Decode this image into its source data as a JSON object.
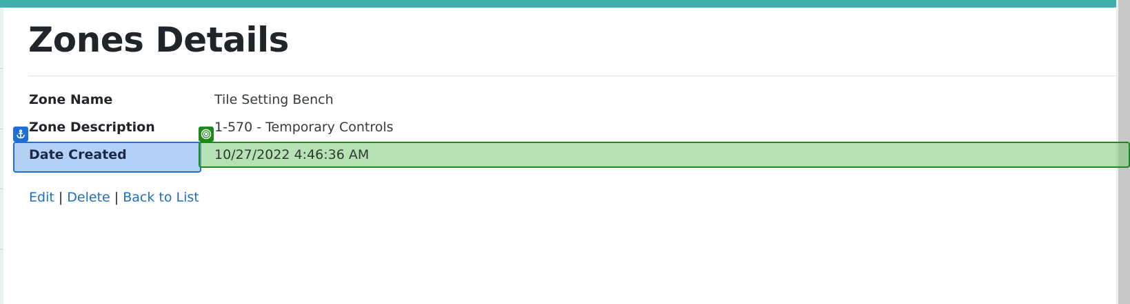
{
  "colors": {
    "accent": "#3cb1a8",
    "link": "#1b6ec2",
    "highlight_label": "#1f6fd6",
    "highlight_value": "#1b8a1b"
  },
  "page": {
    "title": "Zones Details"
  },
  "details": [
    {
      "label": "Zone Name",
      "value": "Tile Setting Bench"
    },
    {
      "label": "Zone Description",
      "value": "1-570 - Temporary Controls"
    },
    {
      "label": "Date Created",
      "value": "10/27/2022 4:46:36 AM"
    }
  ],
  "overlays": {
    "label_marker_icon": "anchor-icon",
    "value_marker_icon": "target-icon"
  },
  "actions": {
    "edit_label": "Edit",
    "delete_label": "Delete",
    "back_label": "Back to List",
    "separator": "|"
  }
}
